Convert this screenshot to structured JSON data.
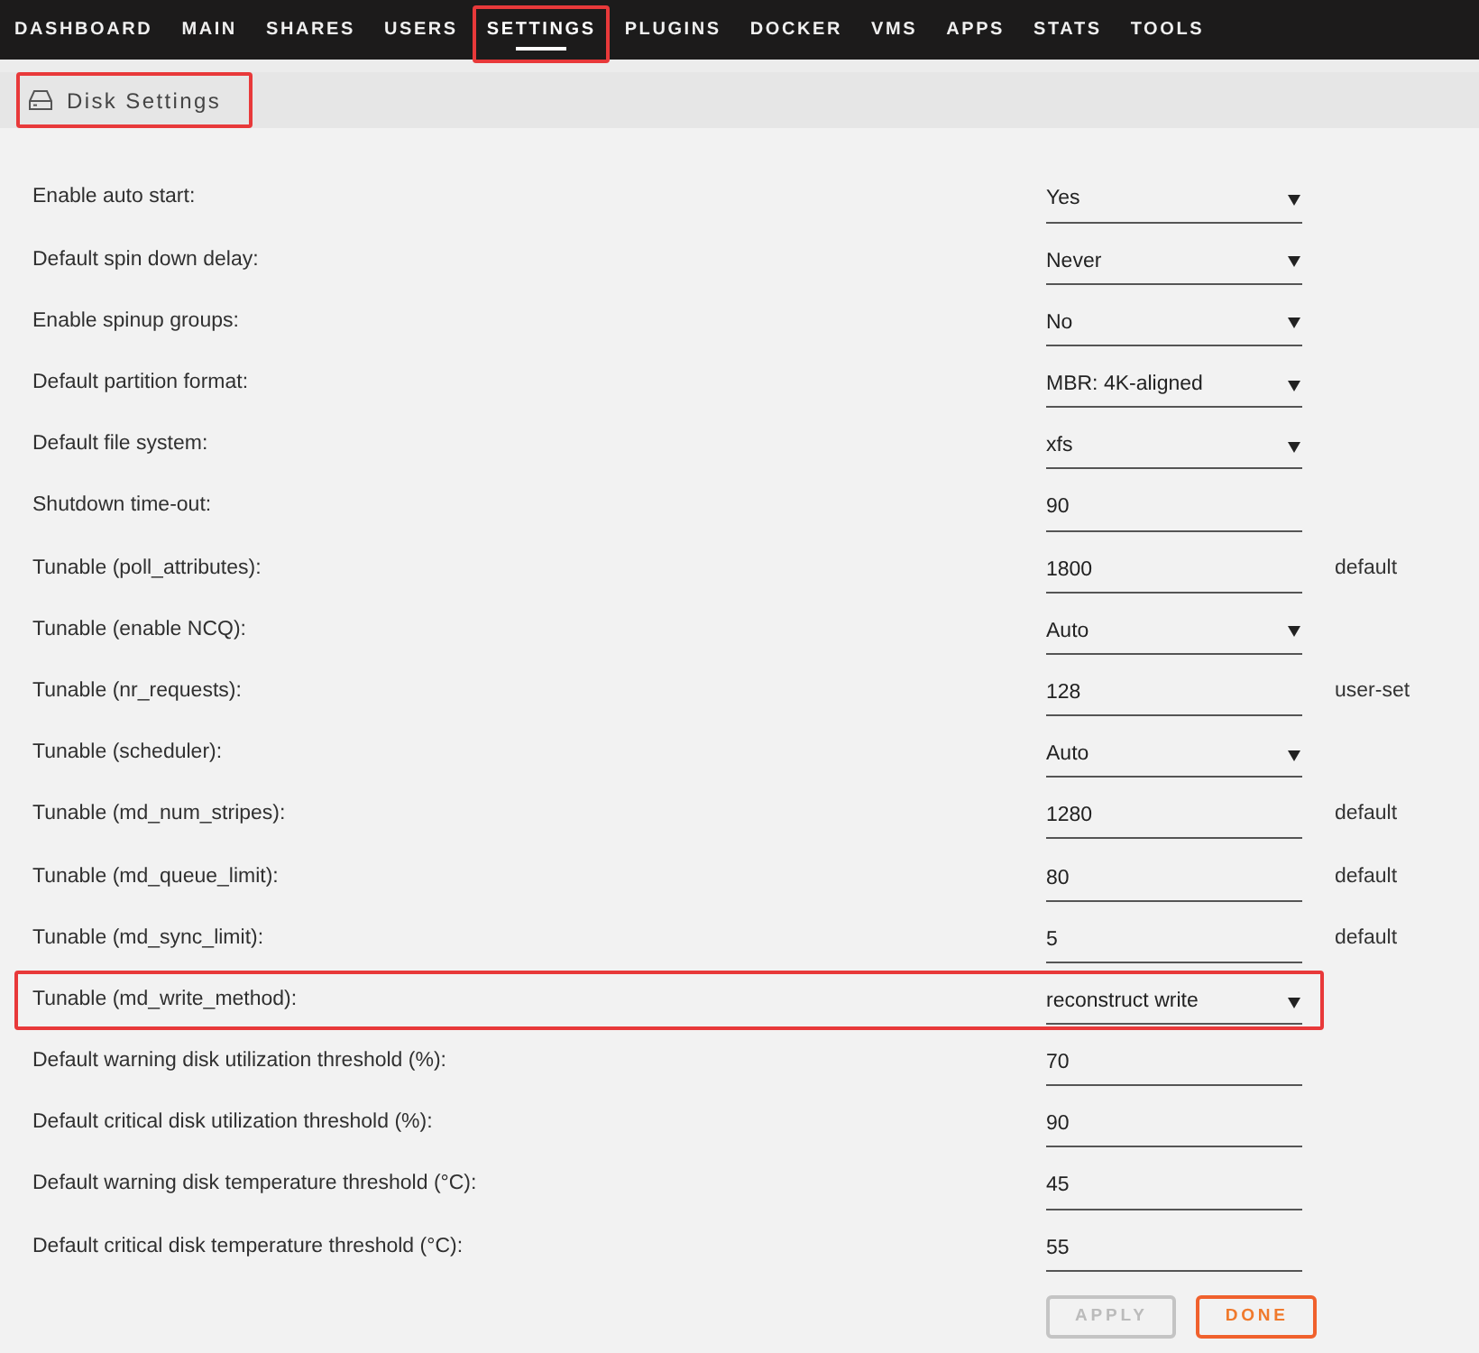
{
  "nav": {
    "tabs": [
      {
        "label": "DASHBOARD",
        "selected": false,
        "highlighted": false
      },
      {
        "label": "MAIN",
        "selected": false,
        "highlighted": false
      },
      {
        "label": "SHARES",
        "selected": false,
        "highlighted": false
      },
      {
        "label": "USERS",
        "selected": false,
        "highlighted": false
      },
      {
        "label": "SETTINGS",
        "selected": true,
        "highlighted": true
      },
      {
        "label": "PLUGINS",
        "selected": false,
        "highlighted": false
      },
      {
        "label": "DOCKER",
        "selected": false,
        "highlighted": false
      },
      {
        "label": "VMS",
        "selected": false,
        "highlighted": false
      },
      {
        "label": "APPS",
        "selected": false,
        "highlighted": false
      },
      {
        "label": "STATS",
        "selected": false,
        "highlighted": false
      },
      {
        "label": "TOOLS",
        "selected": false,
        "highlighted": false
      }
    ]
  },
  "page_header": {
    "title": "Disk Settings",
    "highlighted": true
  },
  "settings": [
    {
      "label": "Enable auto start:",
      "kind": "select",
      "value": "Yes",
      "highlighted": false
    },
    {
      "label": "Default spin down delay:",
      "kind": "select",
      "value": "Never",
      "highlighted": false
    },
    {
      "label": "Enable spinup groups:",
      "kind": "select",
      "value": "No",
      "highlighted": false
    },
    {
      "label": "Default partition format:",
      "kind": "select",
      "value": "MBR: 4K-aligned",
      "highlighted": false
    },
    {
      "label": "Default file system:",
      "kind": "select",
      "value": "xfs",
      "highlighted": false
    },
    {
      "label": "Shutdown time-out:",
      "kind": "text",
      "value": "90",
      "highlighted": false
    },
    {
      "label": "Tunable (poll_attributes):",
      "kind": "text",
      "value": "1800",
      "note": "default",
      "highlighted": false
    },
    {
      "label": "Tunable (enable NCQ):",
      "kind": "select",
      "value": "Auto",
      "highlighted": false
    },
    {
      "label": "Tunable (nr_requests):",
      "kind": "text",
      "value": "128",
      "note": "user-set",
      "highlighted": false
    },
    {
      "label": "Tunable (scheduler):",
      "kind": "select",
      "value": "Auto",
      "highlighted": false
    },
    {
      "label": "Tunable (md_num_stripes):",
      "kind": "text",
      "value": "1280",
      "note": "default",
      "highlighted": false
    },
    {
      "label": "Tunable (md_queue_limit):",
      "kind": "text",
      "value": "80",
      "note": "default",
      "highlighted": false
    },
    {
      "label": "Tunable (md_sync_limit):",
      "kind": "text",
      "value": "5",
      "note": "default",
      "highlighted": false
    },
    {
      "label": "Tunable (md_write_method):",
      "kind": "select",
      "value": "reconstruct write",
      "highlighted": true
    },
    {
      "label": "Default warning disk utilization threshold (%):",
      "kind": "text",
      "value": "70",
      "highlighted": false
    },
    {
      "label": "Default critical disk utilization threshold (%):",
      "kind": "text",
      "value": "90",
      "highlighted": false
    },
    {
      "label": "Default warning disk temperature threshold (°C):",
      "kind": "text",
      "value": "45",
      "highlighted": false
    },
    {
      "label": "Default critical disk temperature threshold (°C):",
      "kind": "text",
      "value": "55",
      "highlighted": false
    }
  ],
  "buttons": [
    {
      "label": "APPLY",
      "disabled": true
    },
    {
      "label": "DONE",
      "disabled": false
    }
  ]
}
